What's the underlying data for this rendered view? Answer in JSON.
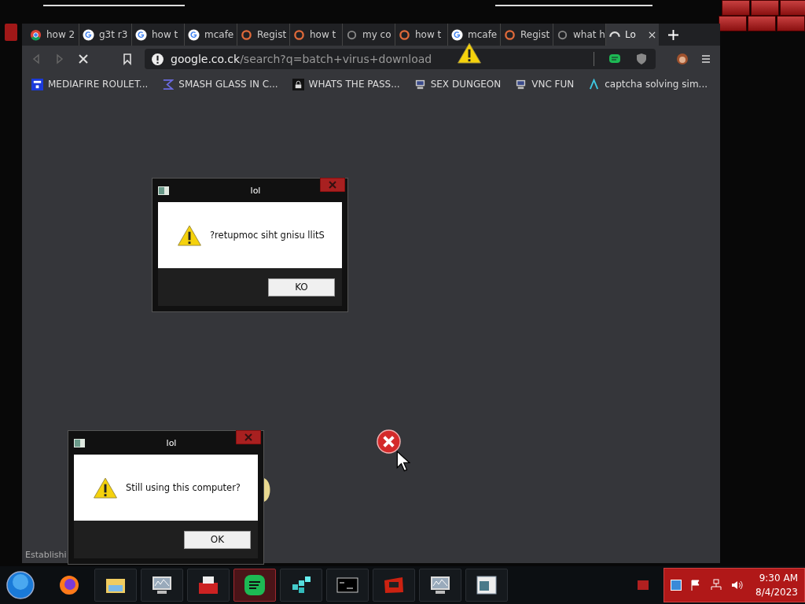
{
  "browser": {
    "tabs": [
      {
        "label": "how 2",
        "kind": "chrome",
        "selected": false
      },
      {
        "label": "g3t r3",
        "kind": "google",
        "selected": false
      },
      {
        "label": "how t",
        "kind": "google",
        "selected": false
      },
      {
        "label": "mcafe",
        "kind": "google",
        "selected": false
      },
      {
        "label": "Regist",
        "kind": "ring",
        "selected": false
      },
      {
        "label": "how t",
        "kind": "ring",
        "selected": false
      },
      {
        "label": "my co",
        "kind": "dim",
        "selected": false
      },
      {
        "label": "how t",
        "kind": "ring",
        "selected": false
      },
      {
        "label": "mcafe",
        "kind": "google",
        "selected": false
      },
      {
        "label": "Regist",
        "kind": "ring",
        "selected": false
      },
      {
        "label": "what h",
        "kind": "dim",
        "selected": false
      },
      {
        "label": "Lo",
        "kind": "spinner",
        "selected": true
      }
    ],
    "address": {
      "host": "google.co.ck",
      "path": "/search?q=batch+virus+download"
    },
    "bookmarks": [
      {
        "label": "MEDIAFIRE ROULET...",
        "kind": "tile"
      },
      {
        "label": "SMASH GLASS IN C...",
        "kind": "sigma"
      },
      {
        "label": "WHATS THE PASS...",
        "kind": "lock"
      },
      {
        "label": "SEX DUNGEON",
        "kind": "computer"
      },
      {
        "label": "VNC FUN",
        "kind": "computer"
      },
      {
        "label": "captcha solving sim...",
        "kind": "lambda"
      }
    ],
    "status": "Establishi"
  },
  "dialogs": [
    {
      "title": "lol",
      "message": "?retupmoc siht gnisu llitS",
      "button": "KO"
    },
    {
      "title": "lol",
      "message": "Still using this computer?",
      "button": "OK"
    }
  ],
  "taskbar": {
    "apps": [
      {
        "kind": "firefox",
        "active": false
      },
      {
        "kind": "folder",
        "active": false
      },
      {
        "kind": "monitor",
        "active": false
      },
      {
        "kind": "toolbox",
        "active": false
      },
      {
        "kind": "spotify",
        "active": true
      },
      {
        "kind": "cubes",
        "active": false
      },
      {
        "kind": "terminal",
        "active": false
      },
      {
        "kind": "redbox",
        "active": false
      },
      {
        "kind": "monitor",
        "active": false
      },
      {
        "kind": "window",
        "active": false
      }
    ],
    "clock": {
      "time": "9:30 AM",
      "date": "8/4/2023"
    }
  }
}
